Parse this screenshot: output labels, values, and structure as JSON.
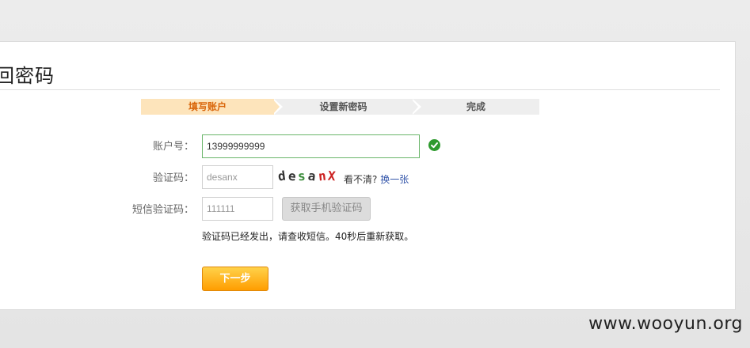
{
  "page": {
    "title": "回密码"
  },
  "steps": [
    {
      "label": "填写账户"
    },
    {
      "label": "设置新密码"
    },
    {
      "label": "完成"
    }
  ],
  "form": {
    "account": {
      "label": "账户号：",
      "value": "13999999999"
    },
    "captcha": {
      "label": "验证码：",
      "placeholder": "desanx",
      "chars": [
        {
          "c": "d",
          "color": "#333333"
        },
        {
          "c": "e",
          "color": "#333333"
        },
        {
          "c": "s",
          "color": "#3a8c3a"
        },
        {
          "c": "a",
          "color": "#333333"
        },
        {
          "c": "n",
          "color": "#cc2222"
        },
        {
          "c": "X",
          "color": "#cc2222"
        }
      ],
      "hint": "看不清?",
      "refresh_label": "换一张"
    },
    "sms": {
      "label": "短信验证码：",
      "placeholder": "111111",
      "button_label": "获取手机验证码",
      "message": "验证码已经发出，请查收短信。40秒后重新获取。"
    },
    "next_label": "下一步"
  },
  "watermark": "www.wooyun.org",
  "colors": {
    "accent": "#ff9d00",
    "active_step_bg": "#fde4bb",
    "active_step_text": "#d9660b",
    "success": "#2d9a2d",
    "link": "#3355aa"
  }
}
